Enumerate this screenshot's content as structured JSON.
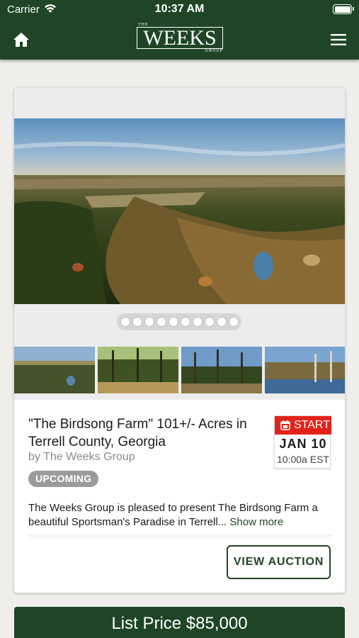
{
  "status_bar": {
    "carrier": "Carrier",
    "time": "10:37 AM"
  },
  "header": {
    "logo": {
      "top": "THE",
      "name": "WEEKS",
      "bottom": "GROUP"
    },
    "home_icon": "home-icon",
    "menu_icon": "hamburger-menu-icon",
    "color": "#1f4526"
  },
  "listing": {
    "title": "\"The Birdsong Farm\" 101+/- Acres in Terrell County, Georgia",
    "byline": "by The Weeks Group",
    "status_badge": "UPCOMING",
    "start_label": "START",
    "start_date": "JAN 10",
    "start_time": "10:00a EST",
    "description": "The Weeks Group is pleased to present The Birdsong Farm a beautiful Sportsman's Paradise in Terrell...",
    "show_more": "Show more",
    "view_button": "VIEW AUCTION",
    "photo_count": 10,
    "photo_index": 0
  },
  "price_bar": {
    "label": "List Price $85,000"
  },
  "colors": {
    "primary": "#1f4526",
    "accent_red": "#e2231a",
    "badge_gray": "#9b9b9b"
  }
}
